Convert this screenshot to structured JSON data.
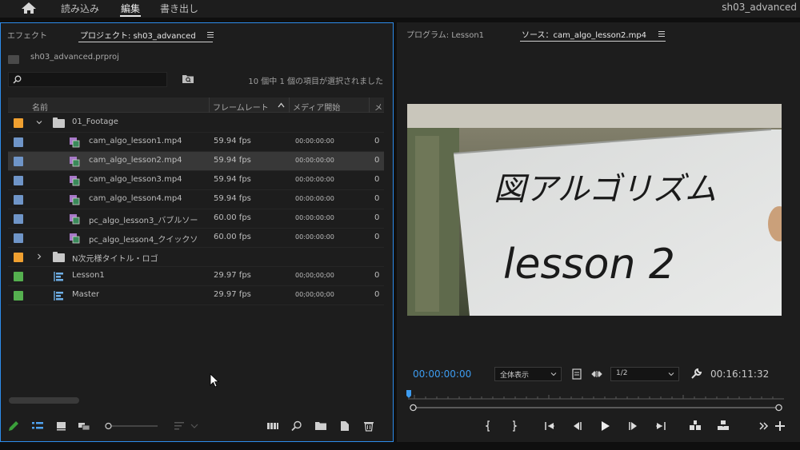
{
  "topbar": {
    "nav": [
      "読み込み",
      "編集",
      "書き出し"
    ],
    "project_name": "sh03_advanced"
  },
  "left_panel": {
    "tabs": [
      "エフェクト",
      "プロジェクト: sh03_advanced"
    ],
    "project_file": "sh03_advanced.prproj",
    "search_placeholder": "",
    "selected_count": "10 個中 1 個の項目が選択されました",
    "columns": [
      "名前",
      "フレームレート",
      "メディア開始",
      "メ"
    ],
    "rows": [
      {
        "name": "01_Footage",
        "fps": "",
        "start": "",
        "type": "folder",
        "color": "#f0a030",
        "expanded": true,
        "cut": ""
      },
      {
        "name": "cam_algo_lesson1.mp4",
        "fps": "59.94 fps",
        "start": "00:00:00:00",
        "type": "clip",
        "color": "#6f95c8",
        "cut": "0"
      },
      {
        "name": "cam_algo_lesson2.mp4",
        "fps": "59.94 fps",
        "start": "00:00:00:00",
        "type": "clip",
        "color": "#6f95c8",
        "selected": true,
        "cut": "0"
      },
      {
        "name": "cam_algo_lesson3.mp4",
        "fps": "59.94 fps",
        "start": "00:00:00:00",
        "type": "clip",
        "color": "#6f95c8",
        "cut": "0"
      },
      {
        "name": "cam_algo_lesson4.mp4",
        "fps": "59.94 fps",
        "start": "00:00:00:00",
        "type": "clip",
        "color": "#6f95c8",
        "cut": "0"
      },
      {
        "name": "pc_algo_lesson3_バブルソー",
        "fps": "60.00 fps",
        "start": "00:00:00:00",
        "type": "clip",
        "color": "#6f95c8",
        "cut": "0"
      },
      {
        "name": "pc_algo_lesson4_クイックソ",
        "fps": "60.00 fps",
        "start": "00:00:00:00",
        "type": "clip",
        "color": "#6f95c8",
        "cut": "0"
      },
      {
        "name": "N次元様タイトル・ロゴ",
        "fps": "",
        "start": "",
        "type": "folder",
        "color": "#f0a030",
        "expanded": false,
        "cut": ""
      },
      {
        "name": "Lesson1",
        "fps": "29.97 fps",
        "start": "00;00;00;00",
        "type": "sequence",
        "color": "#55b04f",
        "cut": "0"
      },
      {
        "name": "Master",
        "fps": "29.97 fps",
        "start": "00;00;00;00",
        "type": "sequence",
        "color": "#55b04f",
        "cut": "0"
      }
    ]
  },
  "right_panel": {
    "tabs": [
      "プログラム: Lesson1",
      "ソース：cam_algo_lesson2.mp4"
    ],
    "timecode_current": "00:00:00:00",
    "fit_option": "全体表示",
    "resolution_option": "1/2",
    "timecode_duration": "00:16:11:32",
    "whiteboard_line1": "図アルゴリズム",
    "whiteboard_line2": "lesson 2"
  },
  "colors": {
    "accent": "#2d8ceb",
    "timecode_blue": "#3d9cf0",
    "label_orange": "#f0a030",
    "label_blue": "#6f95c8",
    "label_green": "#55b04f"
  },
  "icons": [
    "home-icon",
    "search-icon",
    "bin-search-icon",
    "folder-icon",
    "clip-icon",
    "sequence-icon",
    "pencil-icon",
    "list-view-icon",
    "icon-view-icon",
    "freeform-view-icon",
    "sort-icon",
    "automate-icon",
    "find-icon",
    "new-bin-icon",
    "new-item-icon",
    "trash-icon",
    "wrench-icon",
    "play-icon",
    "mark-in-icon",
    "mark-out-icon",
    "insert-icon",
    "overwrite-icon",
    "export-frame-icon",
    "add-button-icon"
  ]
}
